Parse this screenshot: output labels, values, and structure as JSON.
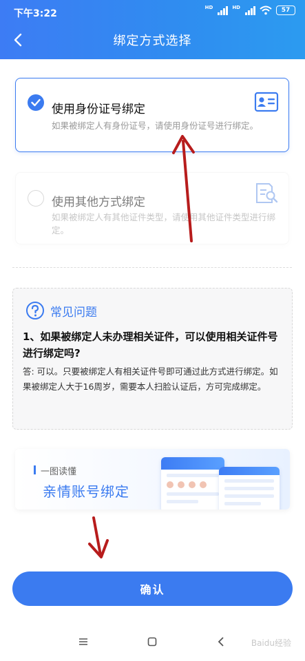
{
  "status_bar": {
    "time": "下午3:22",
    "signal1_label": "HD",
    "signal2_label": "HD",
    "battery": "57"
  },
  "header": {
    "title": "绑定方式选择"
  },
  "options": [
    {
      "title": "使用身份证号绑定",
      "desc": "如果被绑定人有身份证号，请使用身份证号进行绑定。",
      "selected": true,
      "icon": "id-card-icon"
    },
    {
      "title": "使用其他方式绑定",
      "desc": "如果被绑定人有其他证件类型，请使用其他证件类型进行绑定。",
      "selected": false,
      "icon": "document-search-icon"
    }
  ],
  "faq": {
    "title": "常见问题",
    "question": "1、如果被绑定人未办理相关证件，可以使用相关证件号进行绑定吗?",
    "answer": "答: 可以。只要被绑定人有相关证件号即可通过此方式进行绑定。如果被绑定人大于16周岁，需要本人扫脸认证后，方可完成绑定。"
  },
  "banner": {
    "subtitle": "一图读懂",
    "title": "亲情账号绑定"
  },
  "confirm_label": "确认",
  "watermark": "Baidu经验",
  "colors": {
    "accent": "#3b7bf0",
    "annotation": "#b71c1c"
  }
}
